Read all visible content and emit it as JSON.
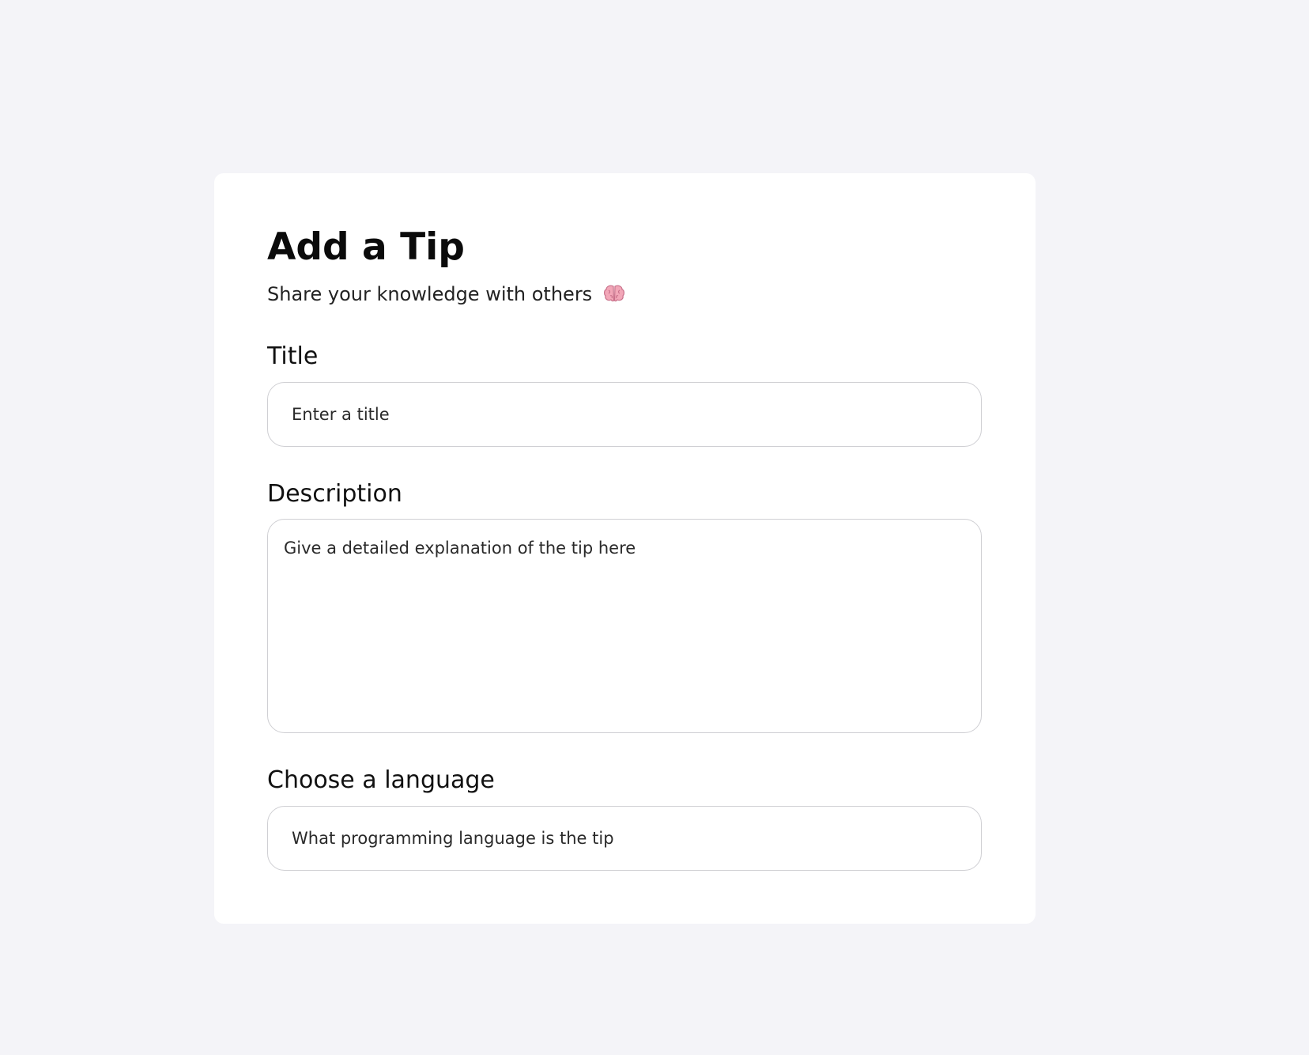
{
  "form": {
    "title": "Add a Tip",
    "subtitle": "Share your knowledge with others",
    "subtitle_icon": "brain-icon",
    "fields": {
      "title": {
        "label": "Title",
        "value": "",
        "placeholder": "Enter a title"
      },
      "description": {
        "label": "Description",
        "value": "",
        "placeholder": "Give a detailed explanation of the tip here"
      },
      "language": {
        "label": "Choose a language",
        "value": "",
        "placeholder": "What programming language is the tip"
      }
    }
  },
  "colors": {
    "page_background": "#f4f4f8",
    "card_background": "#ffffff",
    "input_border": "#cfcfd3",
    "text": "#111111"
  }
}
